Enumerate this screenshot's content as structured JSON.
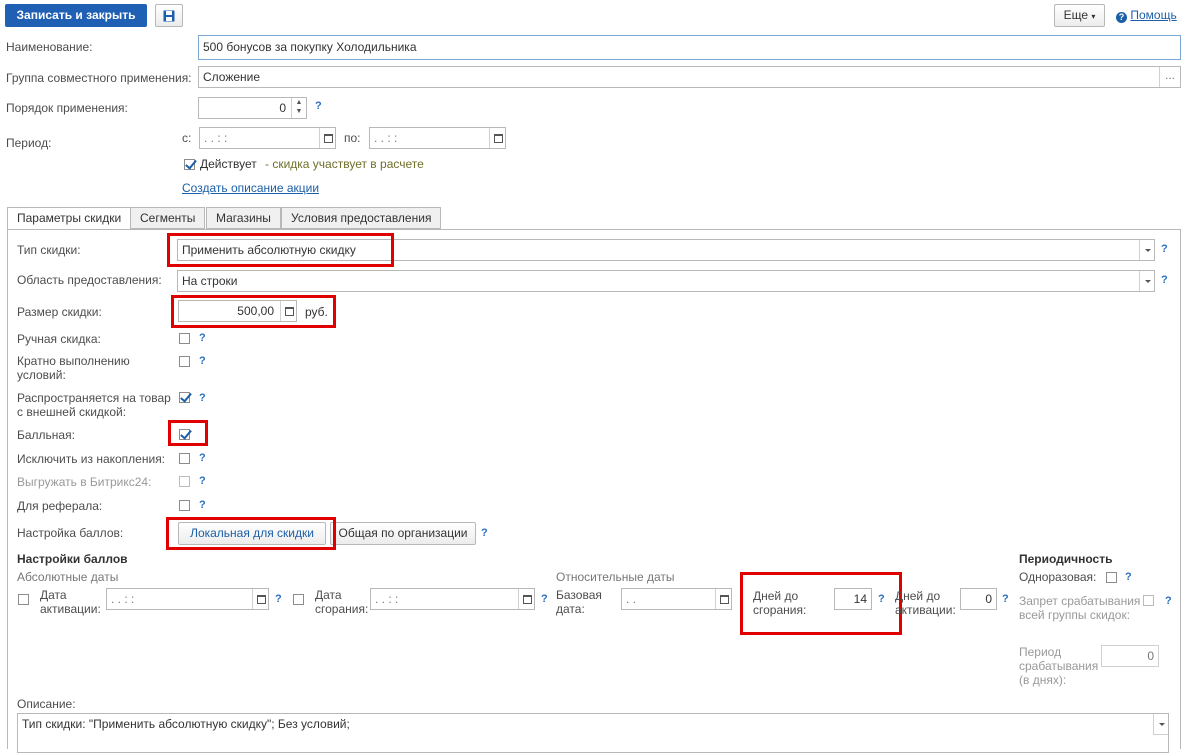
{
  "toolbar": {
    "save_close": "Записать и закрыть",
    "more": "Еще",
    "help": "Помощь"
  },
  "form": {
    "name_label": "Наименование:",
    "name_value": "500 бонусов за покупку Холодильника",
    "group_label": "Группа совместного применения:",
    "group_value": "Сложение",
    "order_label": "Порядок применения:",
    "order_value": "0",
    "period_label": "Период:",
    "from_label": "с:",
    "to_label": "по:",
    "date_placeholder": " .  .      :  :",
    "active_label": "Действует",
    "active_note": "- скидка участвует в расчете",
    "create_desc_link": "Создать описание акции"
  },
  "tabs": [
    "Параметры скидки",
    "Сегменты",
    "Магазины",
    "Условия предоставления"
  ],
  "params": {
    "type_label": "Тип скидки:",
    "type_value": "Применить абсолютную скидку",
    "area_label": "Область предоставления:",
    "area_value": "На строки",
    "size_label": "Размер скидки:",
    "size_value": "500,00",
    "size_unit": "руб.",
    "manual_label": "Ручная скидка:",
    "multiple_label": "Кратно выполнению условий:",
    "external_label": "Распространяется на товар с внешней скидкой:",
    "points_label": "Балльная:",
    "exclude_label": "Исключить из накопления:",
    "bitrix_label": "Выгружать в Битрикс24:",
    "referral_label": "Для реферала:",
    "points_setting_label": "Настройка баллов:",
    "local_btn": "Локальная для скидки",
    "common_btn": "Общая по организации"
  },
  "points": {
    "header": "Настройки баллов",
    "abs_dates": "Абсолютные даты",
    "activation_date": "Дата активации:",
    "burn_date": "Дата сгорания:",
    "rel_dates": "Относительные даты",
    "base_date": "Базовая дата:",
    "base_placeholder": " .  .",
    "days_burn": "Дней до сгорания:",
    "days_burn_value": "14",
    "days_activation": "Дней до активации:",
    "days_activation_value": "0"
  },
  "periodicity": {
    "header": "Периодичность",
    "one_time": "Одноразовая:",
    "ban_group": "Запрет срабатывания всей группы скидок:",
    "period_label": "Период срабатывания (в днях):",
    "period_value": "0"
  },
  "description": {
    "label": "Описание:",
    "value": "Тип скидки: \"Применить абсолютную скидку\"; Без условий;"
  },
  "checks": {
    "active": true,
    "manual": false,
    "multiple": false,
    "external": true,
    "points": true,
    "exclude": false,
    "bitrix": false,
    "referral": false,
    "activation": false,
    "burn": false,
    "one_time": false,
    "ban_group": false
  },
  "colors": {
    "primary": "#1b5fa8",
    "highlight": "#e00000",
    "help": "#2a6fbf"
  }
}
